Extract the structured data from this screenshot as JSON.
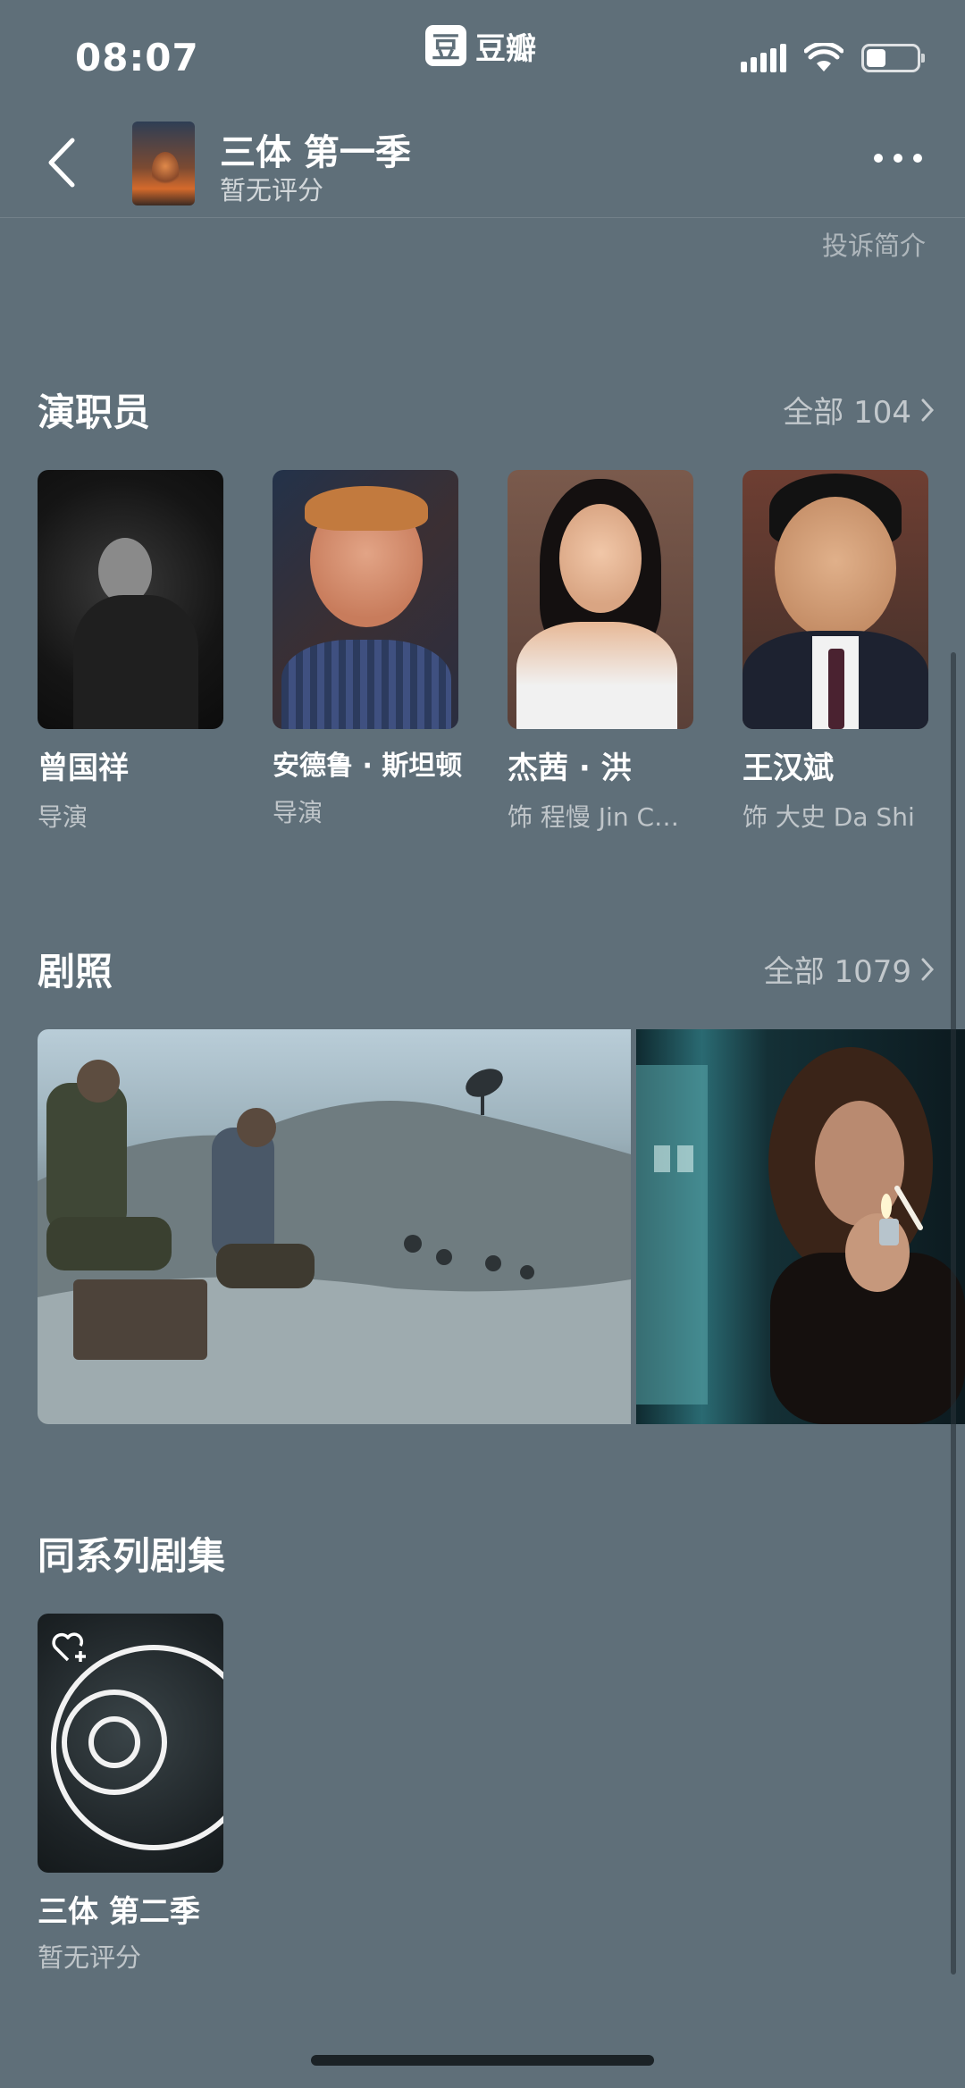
{
  "status_bar": {
    "time": "08:07"
  },
  "app": {
    "logo_glyph": "豆",
    "name": "豆瓣"
  },
  "nav": {
    "title": "三体 第一季",
    "rating": "暂无评分"
  },
  "report_link": "投诉简介",
  "cast_section": {
    "title": "演职员",
    "more_label": "全部 104",
    "members": [
      {
        "name": "曾国祥",
        "role": "导演"
      },
      {
        "name": "安德鲁 · 斯坦顿",
        "role": "导演"
      },
      {
        "name": "杰茜 · 洪",
        "role": "饰 程慢 Jin Ch..."
      },
      {
        "name": "王汉斌",
        "role": "饰 大史 Da Shi"
      }
    ]
  },
  "stills_section": {
    "title": "剧照",
    "more_label": "全部 1079"
  },
  "series_section": {
    "title": "同系列剧集",
    "items": [
      {
        "name": "三体 第二季",
        "rating": "暂无评分"
      }
    ]
  },
  "icons": {
    "back": "chevron-left-icon",
    "more": "more-dots-icon",
    "chevron": "chevron-right-icon",
    "favorite": "heart-plus-icon"
  },
  "colors": {
    "background": "#5f6f79",
    "text": "#ffffff"
  }
}
